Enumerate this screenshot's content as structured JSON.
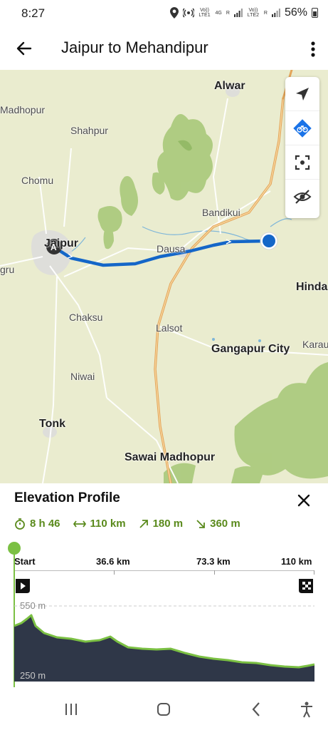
{
  "status_bar": {
    "time": "8:27",
    "battery": "56%",
    "net_1": "4G",
    "lte_1": "Vo)) LTE1",
    "lte_2": "Vo)) LTE2",
    "r_1": "R",
    "r_2": "R"
  },
  "header": {
    "title": "Jaipur to Mehandipur"
  },
  "map": {
    "labels": {
      "alwar": "Alwar",
      "madhopur": "Madhopur",
      "shahpur": "Shahpur",
      "chomu": "Chomu",
      "bandikui": "Bandikui",
      "jaipur": "Jaipur",
      "dausa": "Dausa",
      "gru": "gru",
      "hinda": "Hinda",
      "chaksu": "Chaksu",
      "lalsot": "Lalsot",
      "gangapur": "Gangapur City",
      "karau": "Karau",
      "niwai": "Niwai",
      "tonk": "Tonk",
      "sawai": "Sawai Madhopur"
    },
    "start_marker": "A",
    "route_color": "#1466c8",
    "park_color": "#a9c97a"
  },
  "elevation": {
    "title": "Elevation Profile",
    "duration": "8 h 46",
    "distance": "110 km",
    "ascent": "180 m",
    "descent": "360 m",
    "x_ticks": [
      "Start",
      "36.6 km",
      "73.3 km",
      "110 km"
    ],
    "y_max_label": "550 m",
    "y_min_label": "250 m",
    "accent_color": "#7bc043",
    "fill_color": "#2f3748"
  }
}
